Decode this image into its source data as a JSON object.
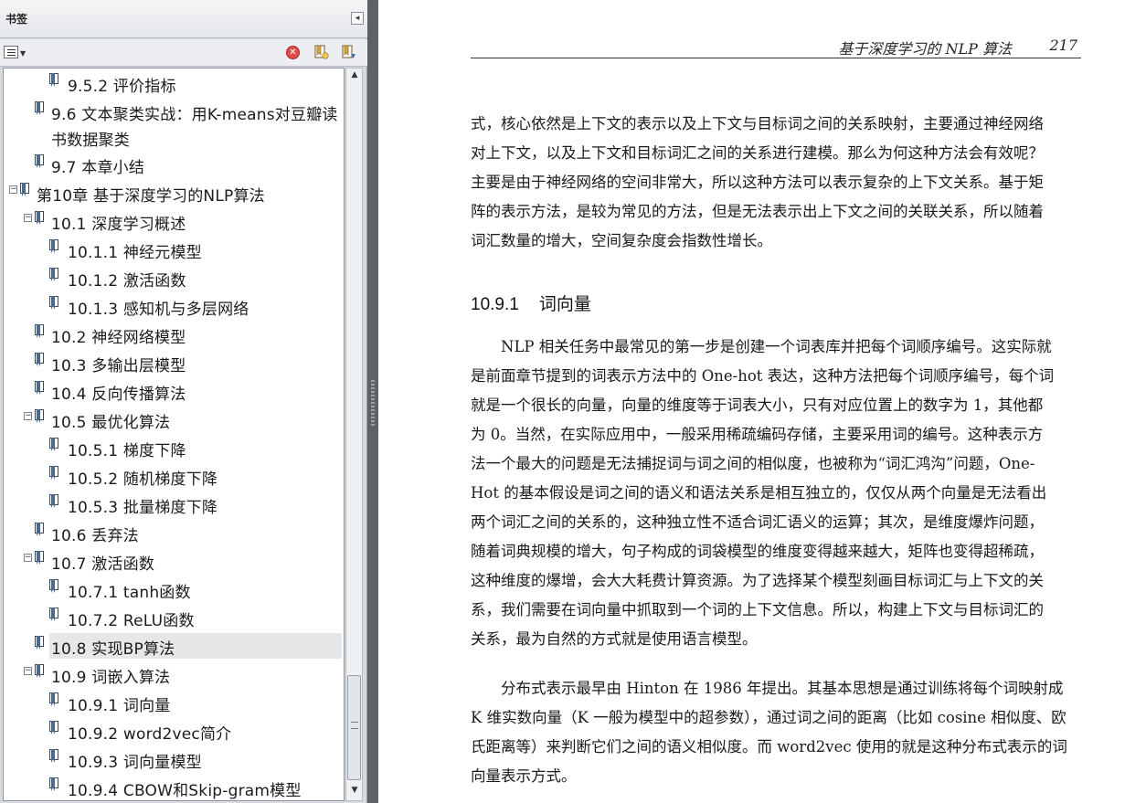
{
  "panel": {
    "title": "书签",
    "collapse_glyph": "◂",
    "delete_glyph": "✕"
  },
  "bookmarks": [
    {
      "label": "9.5.2 评价指标",
      "level": 2
    },
    {
      "label": "9.6 文本聚类实战：用K-means对豆瓣读",
      "label2": "书数据聚类",
      "level": 1
    },
    {
      "label": "9.7 本章小结",
      "level": 1
    },
    {
      "label": "第10章 基于深度学习的NLP算法",
      "level": 0,
      "expanded": true
    },
    {
      "label": "10.1 深度学习概述",
      "level": 1,
      "expanded": true
    },
    {
      "label": "10.1.1 神经元模型",
      "level": 2
    },
    {
      "label": "10.1.2 激活函数",
      "level": 2
    },
    {
      "label": "10.1.3 感知机与多层网络",
      "level": 2
    },
    {
      "label": "10.2 神经网络模型",
      "level": 1
    },
    {
      "label": "10.3 多输出层模型",
      "level": 1
    },
    {
      "label": "10.4 反向传播算法",
      "level": 1
    },
    {
      "label": "10.5 最优化算法",
      "level": 1,
      "expanded": true
    },
    {
      "label": "10.5.1 梯度下降",
      "level": 2
    },
    {
      "label": "10.5.2 随机梯度下降",
      "level": 2
    },
    {
      "label": "10.5.3 批量梯度下降",
      "level": 2
    },
    {
      "label": "10.6 丢弃法",
      "level": 1
    },
    {
      "label": "10.7 激活函数",
      "level": 1,
      "expanded": true
    },
    {
      "label": "10.7.1 tanh函数",
      "level": 2
    },
    {
      "label": "10.7.2 ReLU函数",
      "level": 2
    },
    {
      "label": "10.8 实现BP算法",
      "level": 1,
      "selected": true
    },
    {
      "label": "10.9 词嵌入算法",
      "level": 1,
      "expanded": true
    },
    {
      "label": "10.9.1 词向量",
      "level": 2
    },
    {
      "label": "10.9.2 word2vec简介",
      "level": 2
    },
    {
      "label": "10.9.3 词向量模型",
      "level": 2
    },
    {
      "label": "10.9.4 CBOW和Skip-gram模型",
      "level": 2
    }
  ],
  "page": {
    "header_title": "基于深度学习的 NLP 算法",
    "page_number": "217",
    "para1": [
      "式，核心依然是上下文的表示以及上下文与目标词之间的关系映射，主要通过神经网络",
      "对上下文，以及上下文和目标词汇之间的关系进行建模。那么为何这种方法会有效呢？",
      "主要是由于神经网络的空间非常大，所以这种方法可以表示复杂的上下文关系。基于矩",
      "阵的表示方法，是较为常见的方法，但是无法表示出上下文之间的关联关系，所以随着",
      "词汇数量的增大，空间复杂度会指数性增长。"
    ],
    "section_number": "10.9.1",
    "section_title": "词向量",
    "para2": [
      "　　NLP 相关任务中最常见的第一步是创建一个词表库并把每个词顺序编号。这实际就",
      "是前面章节提到的词表示方法中的 One-hot 表达，这种方法把每个词顺序编号，每个词",
      "就是一个很长的向量，向量的维度等于词表大小，只有对应位置上的数字为 1，其他都",
      "为 0。当然，在实际应用中，一般采用稀疏编码存储，主要采用词的编号。这种表示方",
      "法一个最大的问题是无法捕捉词与词之间的相似度，也被称为“词汇鸿沟”问题，One-",
      "Hot 的基本假设是词之间的语义和语法关系是相互独立的，仅仅从两个向量是无法看出",
      "两个词汇之间的关系的，这种独立性不适合词汇语义的运算；其次，是维度爆炸问题，",
      "随着词典规模的增大，句子构成的词袋模型的维度变得越来越大，矩阵也变得超稀疏，",
      "这种维度的爆增，会大大耗费计算资源。为了选择某个模型刻画目标词汇与上下文的关",
      "系，我们需要在词向量中抓取到一个词的上下文信息。所以，构建上下文与目标词汇的",
      "关系，最为自然的方式就是使用语言模型。"
    ],
    "para3": [
      "　　分布式表示最早由 Hinton 在 1986 年提出。其基本思想是通过训练将每个词映射成",
      "K 维实数向量（K 一般为模型中的超参数），通过词之间的距离（比如 cosine 相似度、欧",
      "氏距离等）来判断它们之间的语义相似度。而 word2vec 使用的就是这种分布式表示的词",
      "向量表示方式。"
    ]
  }
}
